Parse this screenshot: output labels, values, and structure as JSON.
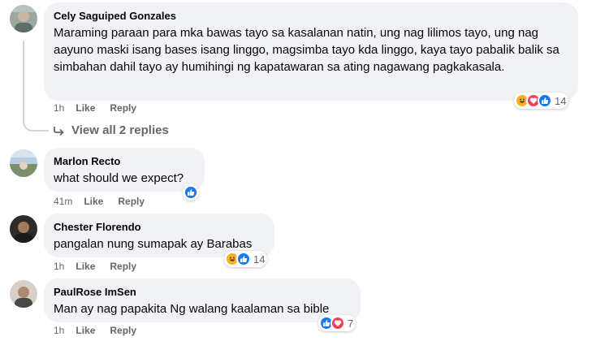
{
  "comments": [
    {
      "author": "Cely Saguiped Gonzales",
      "text": "Maraming paraan para mka bawas tayo sa kasalanan natin, ung nag lilimos tayo, ung nag aayuno maski isang bases isang linggo, magsimba tayo kda linggo, kaya tayo pabalik balik sa simbahan dahil tayo ay humihingi ng kapatawaran sa ating nagawang pagkakasala.",
      "time": "1h",
      "like": "Like",
      "reply": "Reply",
      "reaction_icons": [
        "haha-icon",
        "love-icon",
        "like-icon"
      ],
      "reaction_count": "14"
    },
    {
      "author": "Marlon Recto",
      "text": "what should we expect?",
      "time": "41m",
      "like": "Like",
      "reply": "Reply",
      "reaction_icons": [
        "like-icon"
      ],
      "reaction_count": ""
    },
    {
      "author": "Chester Florendo",
      "text": "pangalan nung sumapak ay Barabas",
      "time": "1h",
      "like": "Like",
      "reply": "Reply",
      "reaction_icons": [
        "haha-icon",
        "like-icon"
      ],
      "reaction_count": "14"
    },
    {
      "author": "PaulRose ImSen",
      "text": "Man ay nag papakita Ng walang kaalaman sa bible",
      "time": "1h",
      "like": "Like",
      "reply": "Reply",
      "reaction_icons": [
        "like-icon",
        "love-icon"
      ],
      "reaction_count": "7"
    }
  ],
  "view_replies": "View all 2 replies",
  "colors": {
    "bubble_bg": "#f0f2f5",
    "meta_text": "#65676b",
    "like_blue": "#1877f2",
    "love_red": "#f33e58",
    "haha_yellow": "#f7b125"
  }
}
